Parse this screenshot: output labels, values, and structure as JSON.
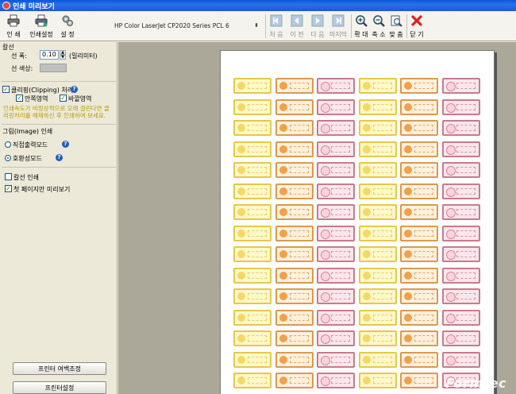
{
  "window": {
    "title": "인쇄 미리보기"
  },
  "toolbar": {
    "print_label": "인 쇄",
    "print_setup_label": "인쇄설정",
    "settings_label": "설 정",
    "printer_name": "HP Color LaserJet CP2020 Series PCL 6",
    "first_label": "처 음",
    "prev_label": "이 전",
    "next_label": "다 음",
    "last_label": "마지막",
    "zoom_in_label": "확 대",
    "zoom_out_label": "축 소",
    "fit_label": "맞 춤",
    "close_label": "닫 기"
  },
  "panel": {
    "grid_title": "칼선",
    "line_width_label": "선 폭:",
    "line_width_value": "0.10",
    "line_width_unit": "(밀리미터)",
    "line_color_label": "선 색상:",
    "line_color_value": "#c0c0c0",
    "clipping_label": "클리핑(Clipping) 처리",
    "clip_inner_label": "안쪽영역",
    "clip_outer_label": "바깥영역",
    "clipping_hint": "인쇄속도가 비정상적으로 오래 걸린다면 클리핑처리를 해제하신 후 인쇄하여 보세요.",
    "image_print_title": "그림(Image) 인쇄",
    "direct_mode_label": "직접출력모드",
    "compat_mode_label": "호환성모드",
    "print_grid_label": "칼선 인쇄",
    "first_page_only_label": "첫 페이지만 미리보기",
    "margin_button_label": "프린터 여백조정",
    "printer_setup_button_label": "프린터설정"
  },
  "preview": {
    "label_columns": [
      "yellow",
      "orange",
      "pink",
      "yellow",
      "orange",
      "pink"
    ],
    "label_rows": 15,
    "watermark": "Formtec"
  },
  "colors": {
    "titlebar": "#1a5ad6",
    "hint_text": "#b89a00",
    "close_icon": "#e02020"
  }
}
